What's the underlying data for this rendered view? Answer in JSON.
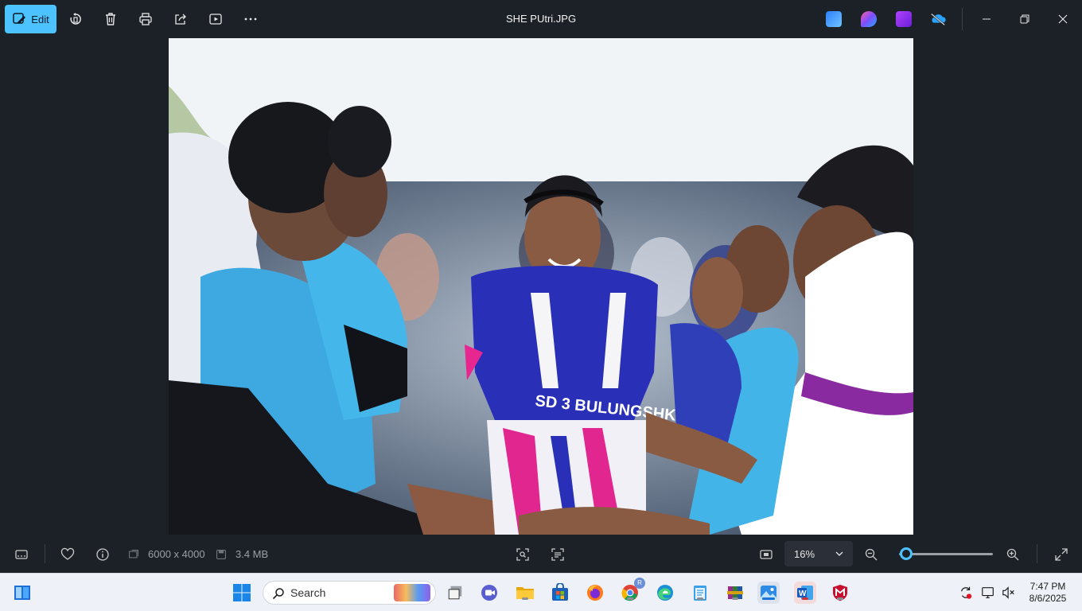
{
  "toolbar": {
    "edit_label": "Edit",
    "file_title": "SHE PUtri.JPG"
  },
  "icons": {
    "rotate": "rotate-icon",
    "delete": "trash-icon",
    "print": "print-icon",
    "share": "share-icon",
    "slideshow": "play-icon",
    "more": "more-icon"
  },
  "info": {
    "dimensions": "6000 x 4000",
    "file_size": "3.4 MB"
  },
  "zoom": {
    "level": "16%",
    "slider_fraction": 0.08
  },
  "taskbar": {
    "search_placeholder": "Search",
    "profile_badge": "R",
    "time": "7:47 PM",
    "date": "8/6/2025"
  },
  "colors": {
    "accent": "#4cc2ff",
    "background": "#1c2127",
    "taskbar": "#eef1f7"
  }
}
